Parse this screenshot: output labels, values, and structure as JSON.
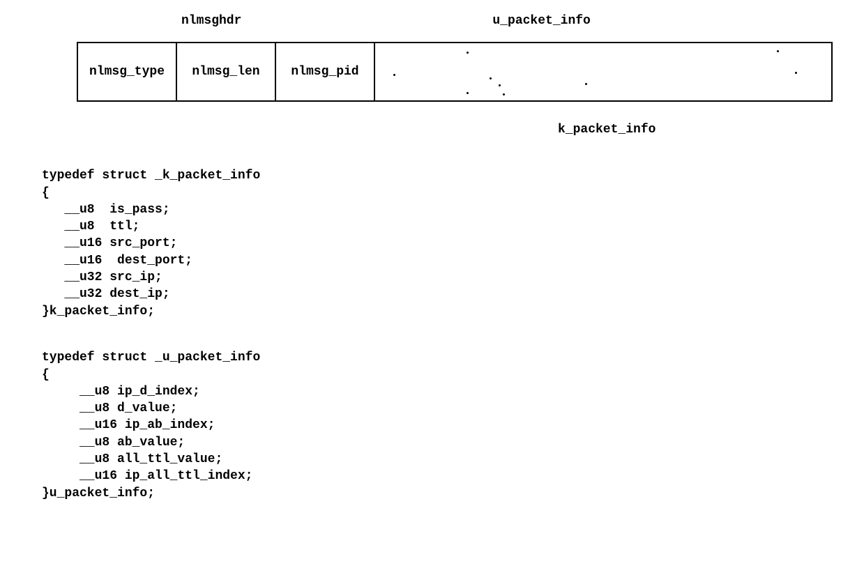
{
  "headers": {
    "nlmsghdr": "nlmsghdr",
    "u_packet_info": "u_packet_info",
    "k_packet_info": "k_packet_info"
  },
  "table": {
    "cell1": "nlmsg_type",
    "cell2": "nlmsg_len",
    "cell3": "nlmsg_pid"
  },
  "struct1": {
    "line1": "typedef struct _k_packet_info",
    "line2": "{",
    "line3": "   __u8  is_pass;",
    "line4": "   __u8  ttl;",
    "line5": "   __u16 src_port;",
    "line6": "   __u16  dest_port;",
    "line7": "   __u32 src_ip;",
    "line8": "   __u32 dest_ip;",
    "line9": "}k_packet_info;"
  },
  "struct2": {
    "line1": "typedef struct _u_packet_info",
    "line2": "{",
    "line3": "     __u8 ip_d_index;",
    "line4": "     __u8 d_value;",
    "line5": "     __u16 ip_ab_index;",
    "line6": "     __u8 ab_value;",
    "line7": "     __u8 all_ttl_value;",
    "line8": "     __u16 ip_all_ttl_index;",
    "line9": "}u_packet_info;"
  }
}
